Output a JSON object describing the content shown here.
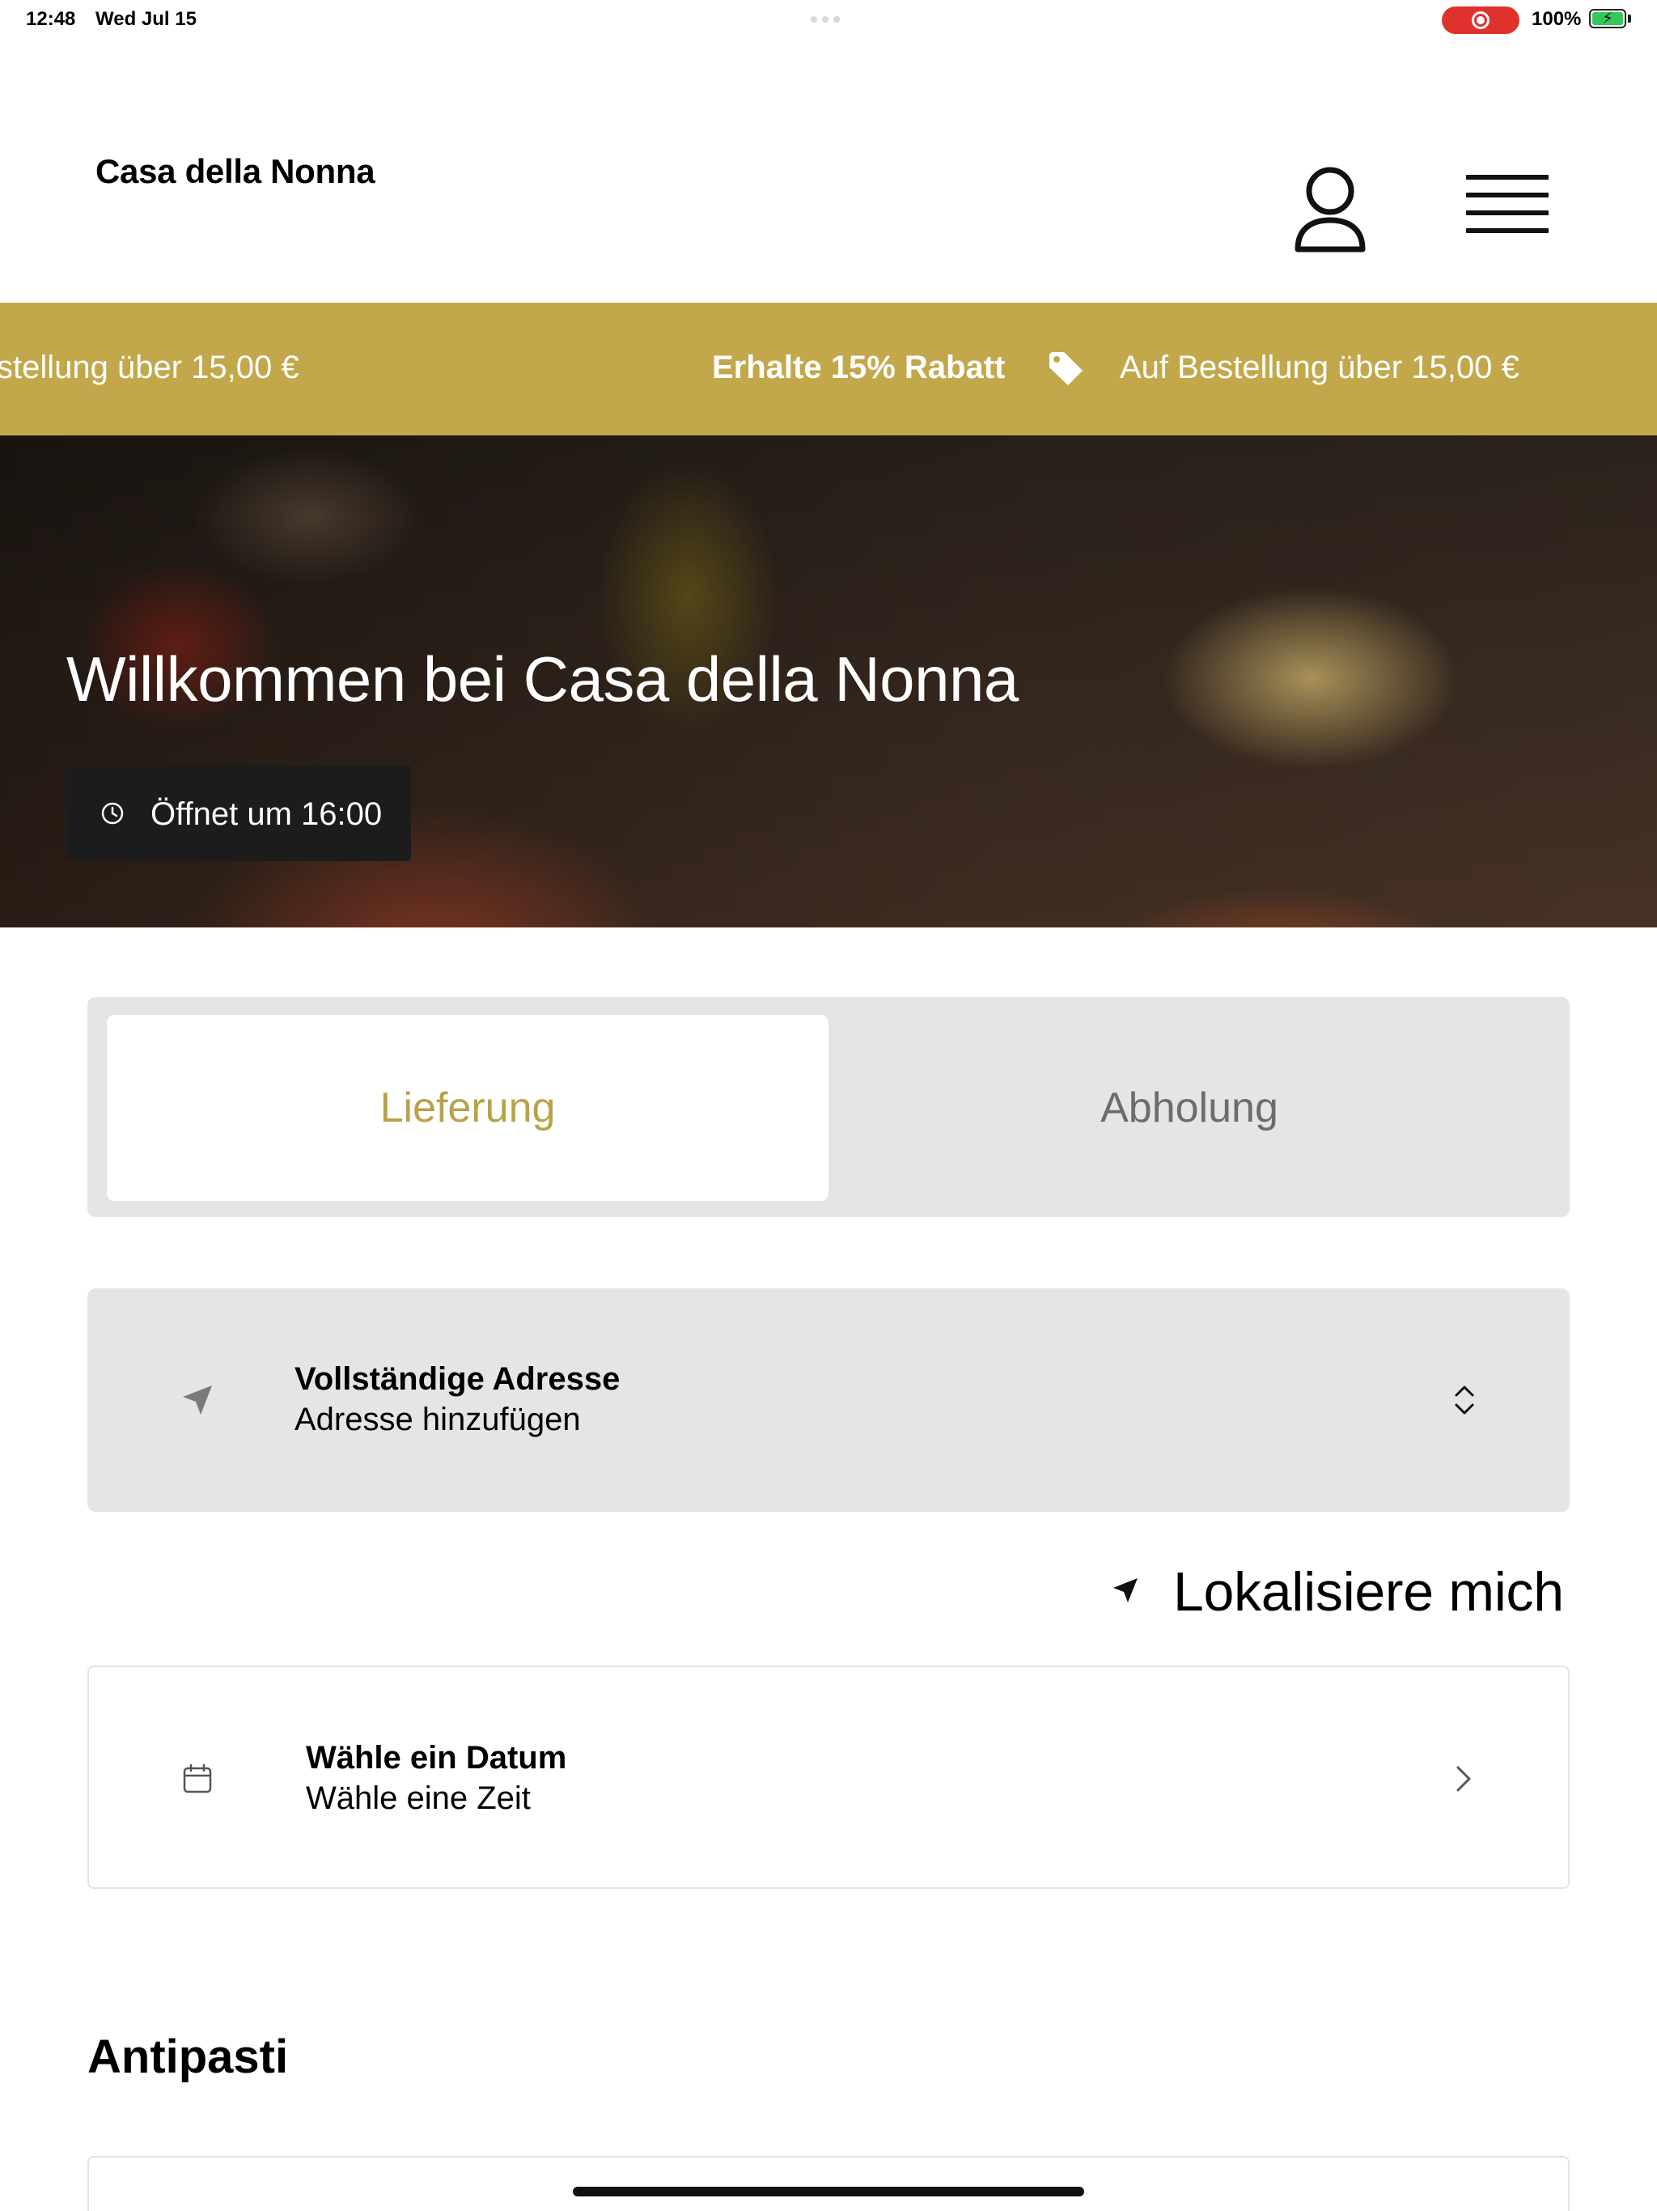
{
  "status_bar": {
    "time": "12:48",
    "date": "Wed Jul 15",
    "battery": "100%",
    "recording_color": "#e0322c"
  },
  "header": {
    "brand": "Casa della Nonna",
    "user_icon": "user-icon",
    "menu_icon": "hamburger-menu-icon"
  },
  "promo": {
    "background": "#c2a84b",
    "text_left_partial": "stellung über 15,00 €",
    "headline": "Erhalte 15% Rabatt",
    "icon": "tag-icon",
    "text": "Auf Bestellung über 15,00 €"
  },
  "hero": {
    "title": "Willkommen bei Casa della Nonna",
    "opening_label": "Öffnet um 16:00",
    "clock_icon": "clock-icon"
  },
  "order_type": {
    "options": [
      "Lieferung",
      "Abholung"
    ],
    "selected": "Lieferung",
    "accent": "#b9a247"
  },
  "address": {
    "title": "Vollständige Adresse",
    "subtitle": "Adresse hinzufügen",
    "icon": "location-arrow-icon",
    "chevron": "chevron-up-down-icon"
  },
  "locate": {
    "label": "Lokalisiere mich",
    "icon": "location-arrow-icon"
  },
  "schedule": {
    "title": "Wähle ein Datum",
    "subtitle": "Wähle eine Zeit",
    "icon": "calendar-icon",
    "chevron": "chevron-right-icon"
  },
  "menu_section": {
    "title": "Antipasti"
  }
}
